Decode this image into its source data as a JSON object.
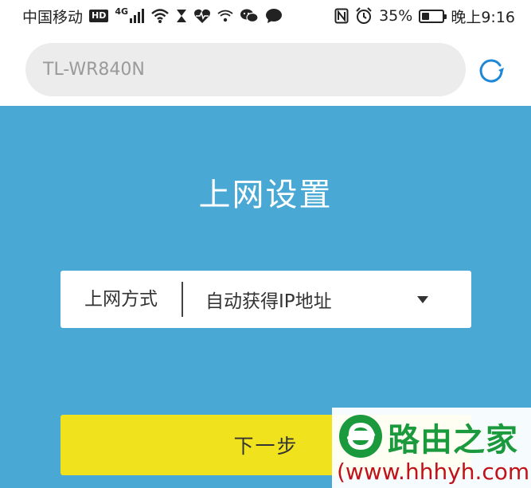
{
  "status_bar": {
    "carrier": "中国移动",
    "hd_badge": "HD",
    "network": "4G",
    "battery_percent": "35%",
    "battery_level": 0.35,
    "time": "晚上9:16",
    "icons": [
      "hourglass-icon",
      "heart-rate-icon",
      "wifi-icon",
      "wechat-icon",
      "message-icon",
      "nfc-icon",
      "alarm-icon"
    ]
  },
  "browser": {
    "url": "TL-WR840N",
    "reload_icon": "reload-icon"
  },
  "page": {
    "title": "上网设置",
    "connection_type_label": "上网方式",
    "connection_type_value": "自动获得IP地址",
    "next_button": "下一步"
  },
  "watermark": {
    "brand": "路由之家",
    "url": "(www.hhhyh.com)"
  },
  "colors": {
    "background": "#4aa9d4",
    "button": "#f1e21e",
    "reload": "#1e88d6",
    "watermark_green": "#1a9a3c",
    "watermark_red": "#c0121a"
  }
}
